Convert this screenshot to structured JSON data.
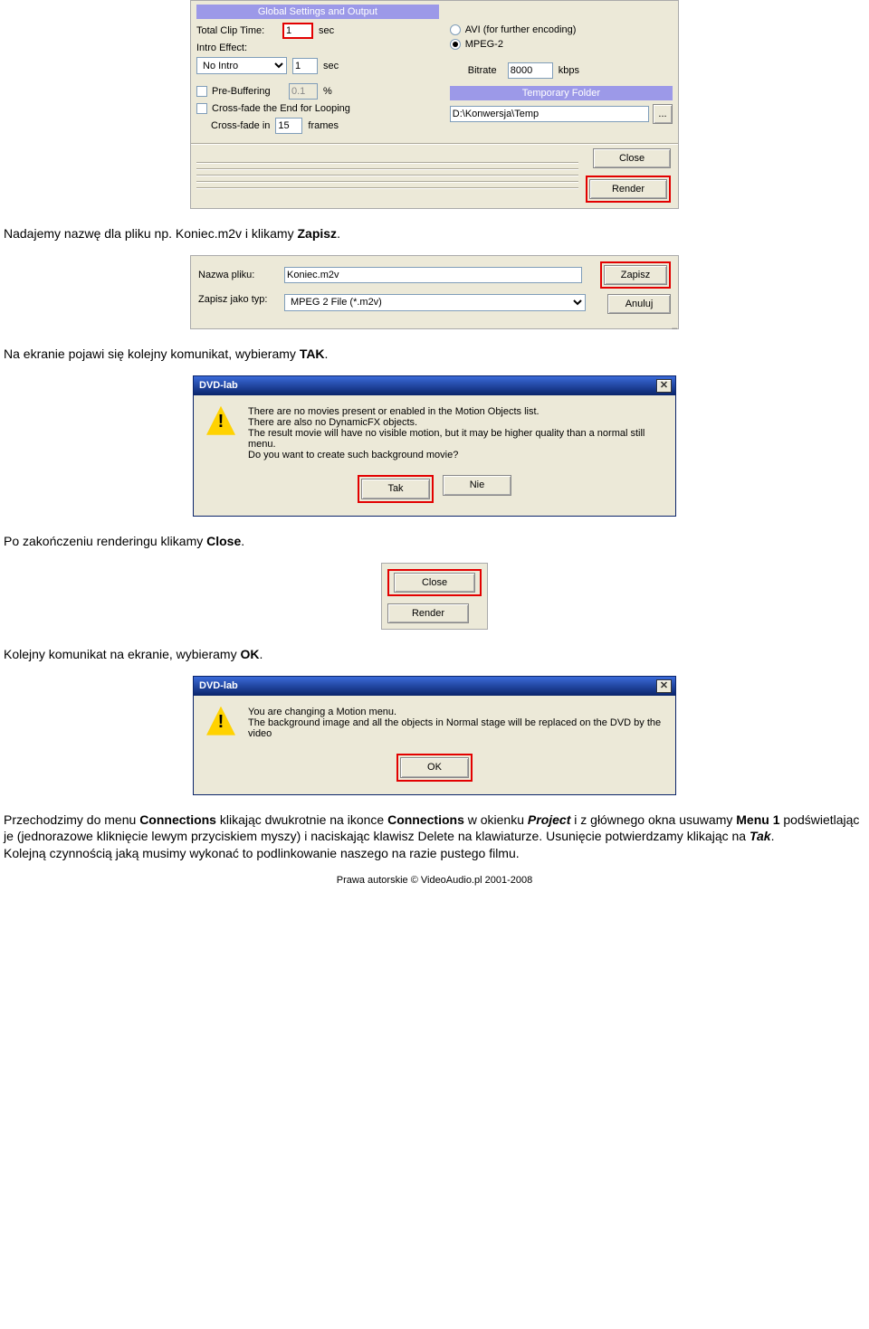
{
  "ss1": {
    "hdr_global": "Global Settings and Output",
    "total_clip_time_lbl": "Total Clip Time:",
    "total_clip_time_val": "1",
    "sec": "sec",
    "intro_lbl": "Intro Effect:",
    "intro_select": "No Intro",
    "intro_sec_val": "1",
    "prebuf_lbl": "Pre-Buffering",
    "prebuf_val": "0.1",
    "percent": "%",
    "crossfade_end_lbl": "Cross-fade the End for Looping",
    "crossfade_in_lbl": "Cross-fade in",
    "crossfade_frames_val": "15",
    "frames": "frames",
    "avi_lbl": "AVI (for further encoding)",
    "mpeg2_lbl": "MPEG-2",
    "bitrate_lbl": "Bitrate",
    "bitrate_val": "8000",
    "kbps": "kbps",
    "hdr_tmp": "Temporary Folder",
    "tmp_path": "D:\\Konwersja\\Temp",
    "browse": "...",
    "close_btn": "Close",
    "render_btn": "Render"
  },
  "p1": "Nadajemy nazwę dla pliku np. Koniec.m2v i klikamy ",
  "p1b": "Zapisz",
  "p1c": ".",
  "ss2": {
    "nazwa_lbl": "Nazwa pliku:",
    "nazwa_val": "Koniec.m2v",
    "typ_lbl": "Zapisz jako typ:",
    "typ_val": "MPEG 2 File (*.m2v)",
    "zapisz": "Zapisz",
    "anuluj": "Anuluj"
  },
  "p2a": "Na ekranie pojawi się kolejny komunikat, wybieramy ",
  "p2b": "TAK",
  "p2c": ".",
  "dlg1": {
    "title": "DVD-lab",
    "l1": "There are no movies present or enabled in the Motion Objects list.",
    "l2": "There are also no DynamicFX objects.",
    "l3": "The result movie will have no visible motion, but it may be higher quality than a normal still menu.",
    "l4": "Do you want to create such background movie?",
    "tak": "Tak",
    "nie": "Nie"
  },
  "p3a": "Po zakończeniu renderingu klikamy ",
  "p3b": "Close",
  "p3c": ".",
  "ss4": {
    "close": "Close",
    "render": "Render"
  },
  "p4a": "Kolejny komunikat na ekranie, wybieramy ",
  "p4b": "OK",
  "p4c": ".",
  "dlg2": {
    "title": "DVD-lab",
    "l1": "You are changing a Motion menu.",
    "l2": "The background image and all the objects in Normal stage will be replaced on the DVD by the video",
    "ok": "OK"
  },
  "p5": {
    "t1": "Przechodzimy do menu ",
    "t2": "Connections",
    "t3": " klikając dwukrotnie na ikonce ",
    "t4": "Connections",
    "t5": " w okienku ",
    "t6": "Project",
    "t7": " i z głównego okna usuwamy ",
    "t8": "Menu 1",
    "t9": " podświetlając je (jednorazowe kliknięcie lewym przyciskiem myszy) i naciskając klawisz Delete na klawiaturze. Usunięcie potwierdzamy klikając na ",
    "t10": "Tak",
    "t11": ".",
    "t12": "Kolejną czynnością jaką musimy wykonać to podlinkowanie naszego na razie pustego filmu."
  },
  "footer": "Prawa autorskie © VideoAudio.pl 2001-2008"
}
